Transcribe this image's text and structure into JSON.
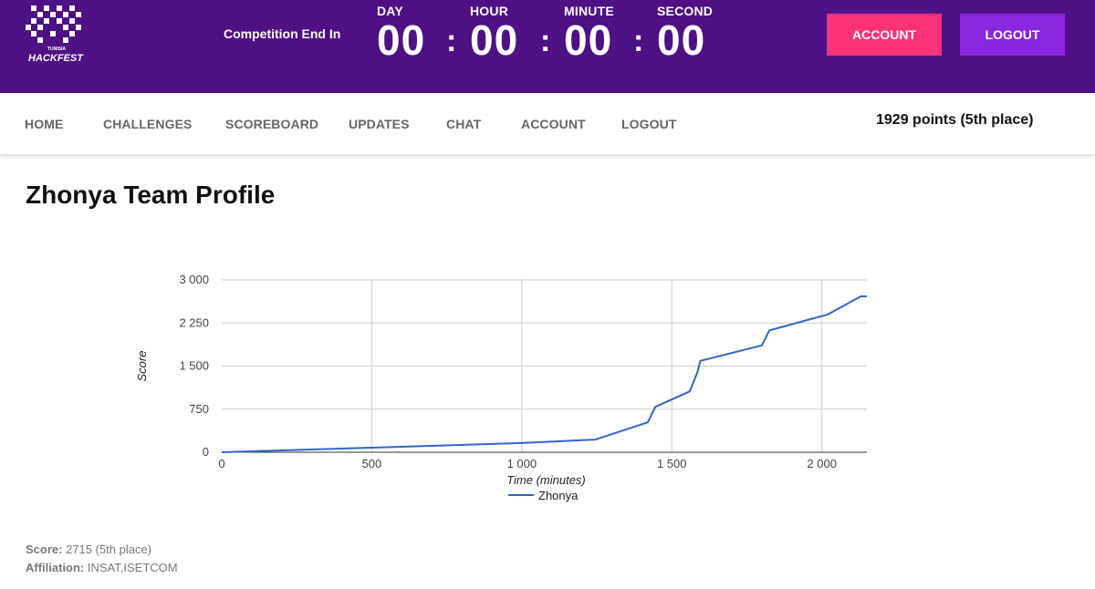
{
  "header": {
    "logo_text_top": "TUNISIA",
    "logo_text": "HACKFEST",
    "competition_label": "Competition End In",
    "countdown": [
      {
        "label": "DAY",
        "value": "00"
      },
      {
        "label": "HOUR",
        "value": "00"
      },
      {
        "label": "MINUTE",
        "value": "00"
      },
      {
        "label": "SECOND",
        "value": "00"
      }
    ],
    "separator": ":",
    "account_button": "ACCOUNT",
    "logout_button": "LOGOUT",
    "colors": {
      "bar": "#4d1185",
      "account": "#fb3278",
      "logout": "#8a26e0"
    }
  },
  "nav": {
    "items": [
      "HOME",
      "CHALLENGES",
      "SCOREBOARD",
      "UPDATES",
      "CHAT",
      "ACCOUNT",
      "LOGOUT"
    ],
    "points_status": "1929 points (5th place)"
  },
  "main": {
    "title": "Zhonya Team Profile",
    "score_label": "Score:",
    "score_value": "2715 (5th place)",
    "affiliation_label": "Affiliation:",
    "affiliation_value": "INSAT,ISETCOM"
  },
  "chart_data": {
    "type": "line",
    "title": "",
    "xlabel": "Time (minutes)",
    "ylabel": "Score",
    "xlim": [
      0,
      2150
    ],
    "ylim": [
      0,
      3000
    ],
    "x_ticks": [
      0,
      500,
      1000,
      1500,
      2000
    ],
    "x_tick_labels": [
      "0",
      "500",
      "1 000",
      "1 500",
      "2 000"
    ],
    "y_ticks": [
      0,
      750,
      1500,
      2250,
      3000
    ],
    "y_tick_labels": [
      "0",
      "750",
      "1 500",
      "2 250",
      "3 000"
    ],
    "grid": true,
    "legend": "bottom",
    "series": [
      {
        "name": "Zhonya",
        "color": "#3366cc",
        "x": [
          0,
          500,
          1000,
          1245,
          1420,
          1445,
          1560,
          1585,
          1595,
          1800,
          1825,
          2020,
          2130,
          2150
        ],
        "y": [
          0,
          80,
          160,
          220,
          520,
          790,
          1060,
          1390,
          1590,
          1860,
          2120,
          2400,
          2715,
          2715
        ]
      }
    ]
  }
}
